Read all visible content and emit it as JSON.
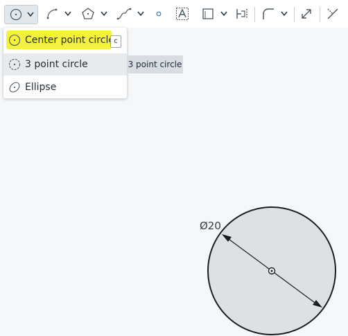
{
  "toolbar": {
    "tools": [
      {
        "name": "circle-tool-icon",
        "active": true
      },
      {
        "name": "arc-tool-icon"
      },
      {
        "name": "polygon-tool-icon"
      },
      {
        "name": "spline-tool-icon"
      },
      {
        "name": "point-tool-icon"
      },
      {
        "name": "text-tool-icon"
      },
      {
        "name": "rectangle-tool-icon"
      },
      {
        "name": "offset-tool-icon"
      },
      {
        "name": "fillet-tool-icon"
      },
      {
        "name": "transform-tool-icon"
      },
      {
        "name": "trim-tool-icon"
      }
    ]
  },
  "circle_menu": {
    "items": [
      {
        "label": "Center point circle",
        "shortcut": "c",
        "highlighted": true
      },
      {
        "label": "3 point circle"
      },
      {
        "label": "Ellipse"
      }
    ]
  },
  "tooltip": {
    "text": "3 point circle"
  },
  "sketch": {
    "dimension_label": "Ø20"
  },
  "colors": {
    "highlight": "#f4f23a",
    "canvas": "#f5f8fa",
    "circle_fill": "#dde1e5",
    "tooltip_bg": "#d7dde3"
  }
}
